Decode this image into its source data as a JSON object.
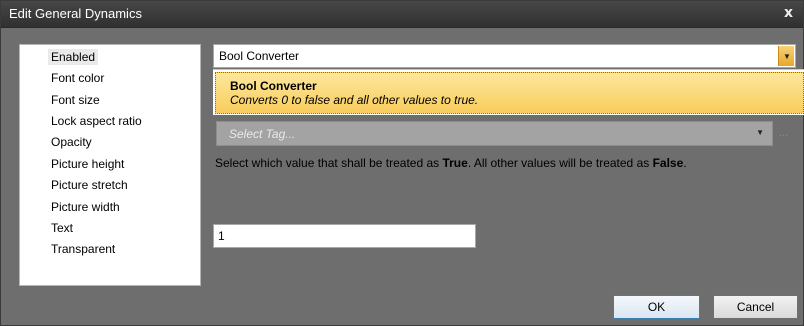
{
  "window": {
    "title": "Edit General Dynamics",
    "close_label": "x"
  },
  "properties": [
    "Enabled",
    "Font color",
    "Font size",
    "Lock aspect ratio",
    "Opacity",
    "Picture height",
    "Picture stretch",
    "Picture width",
    "Text",
    "Transparent"
  ],
  "selected_property": "Enabled",
  "converter": {
    "value": "Bool Converter",
    "dropdown_item_title": "Bool Converter",
    "dropdown_item_description": "Converts 0 to false and all other values to true."
  },
  "tag_select": {
    "placeholder": "Select Tag...",
    "browse_label": "..."
  },
  "info": {
    "part1": "Select which value that shall be treated as ",
    "true_word": "True",
    "part2": ". All other values will be treated as ",
    "false_word": "False",
    "part3": "."
  },
  "value_field": {
    "value": "1"
  },
  "buttons": {
    "ok": "OK",
    "cancel": "Cancel"
  },
  "colors": {
    "title_bar": "#3a3a3a",
    "dialog_bg": "#6e6e6e",
    "highlight": "#f8cd5c",
    "ok_border": "#3c7fb1"
  }
}
